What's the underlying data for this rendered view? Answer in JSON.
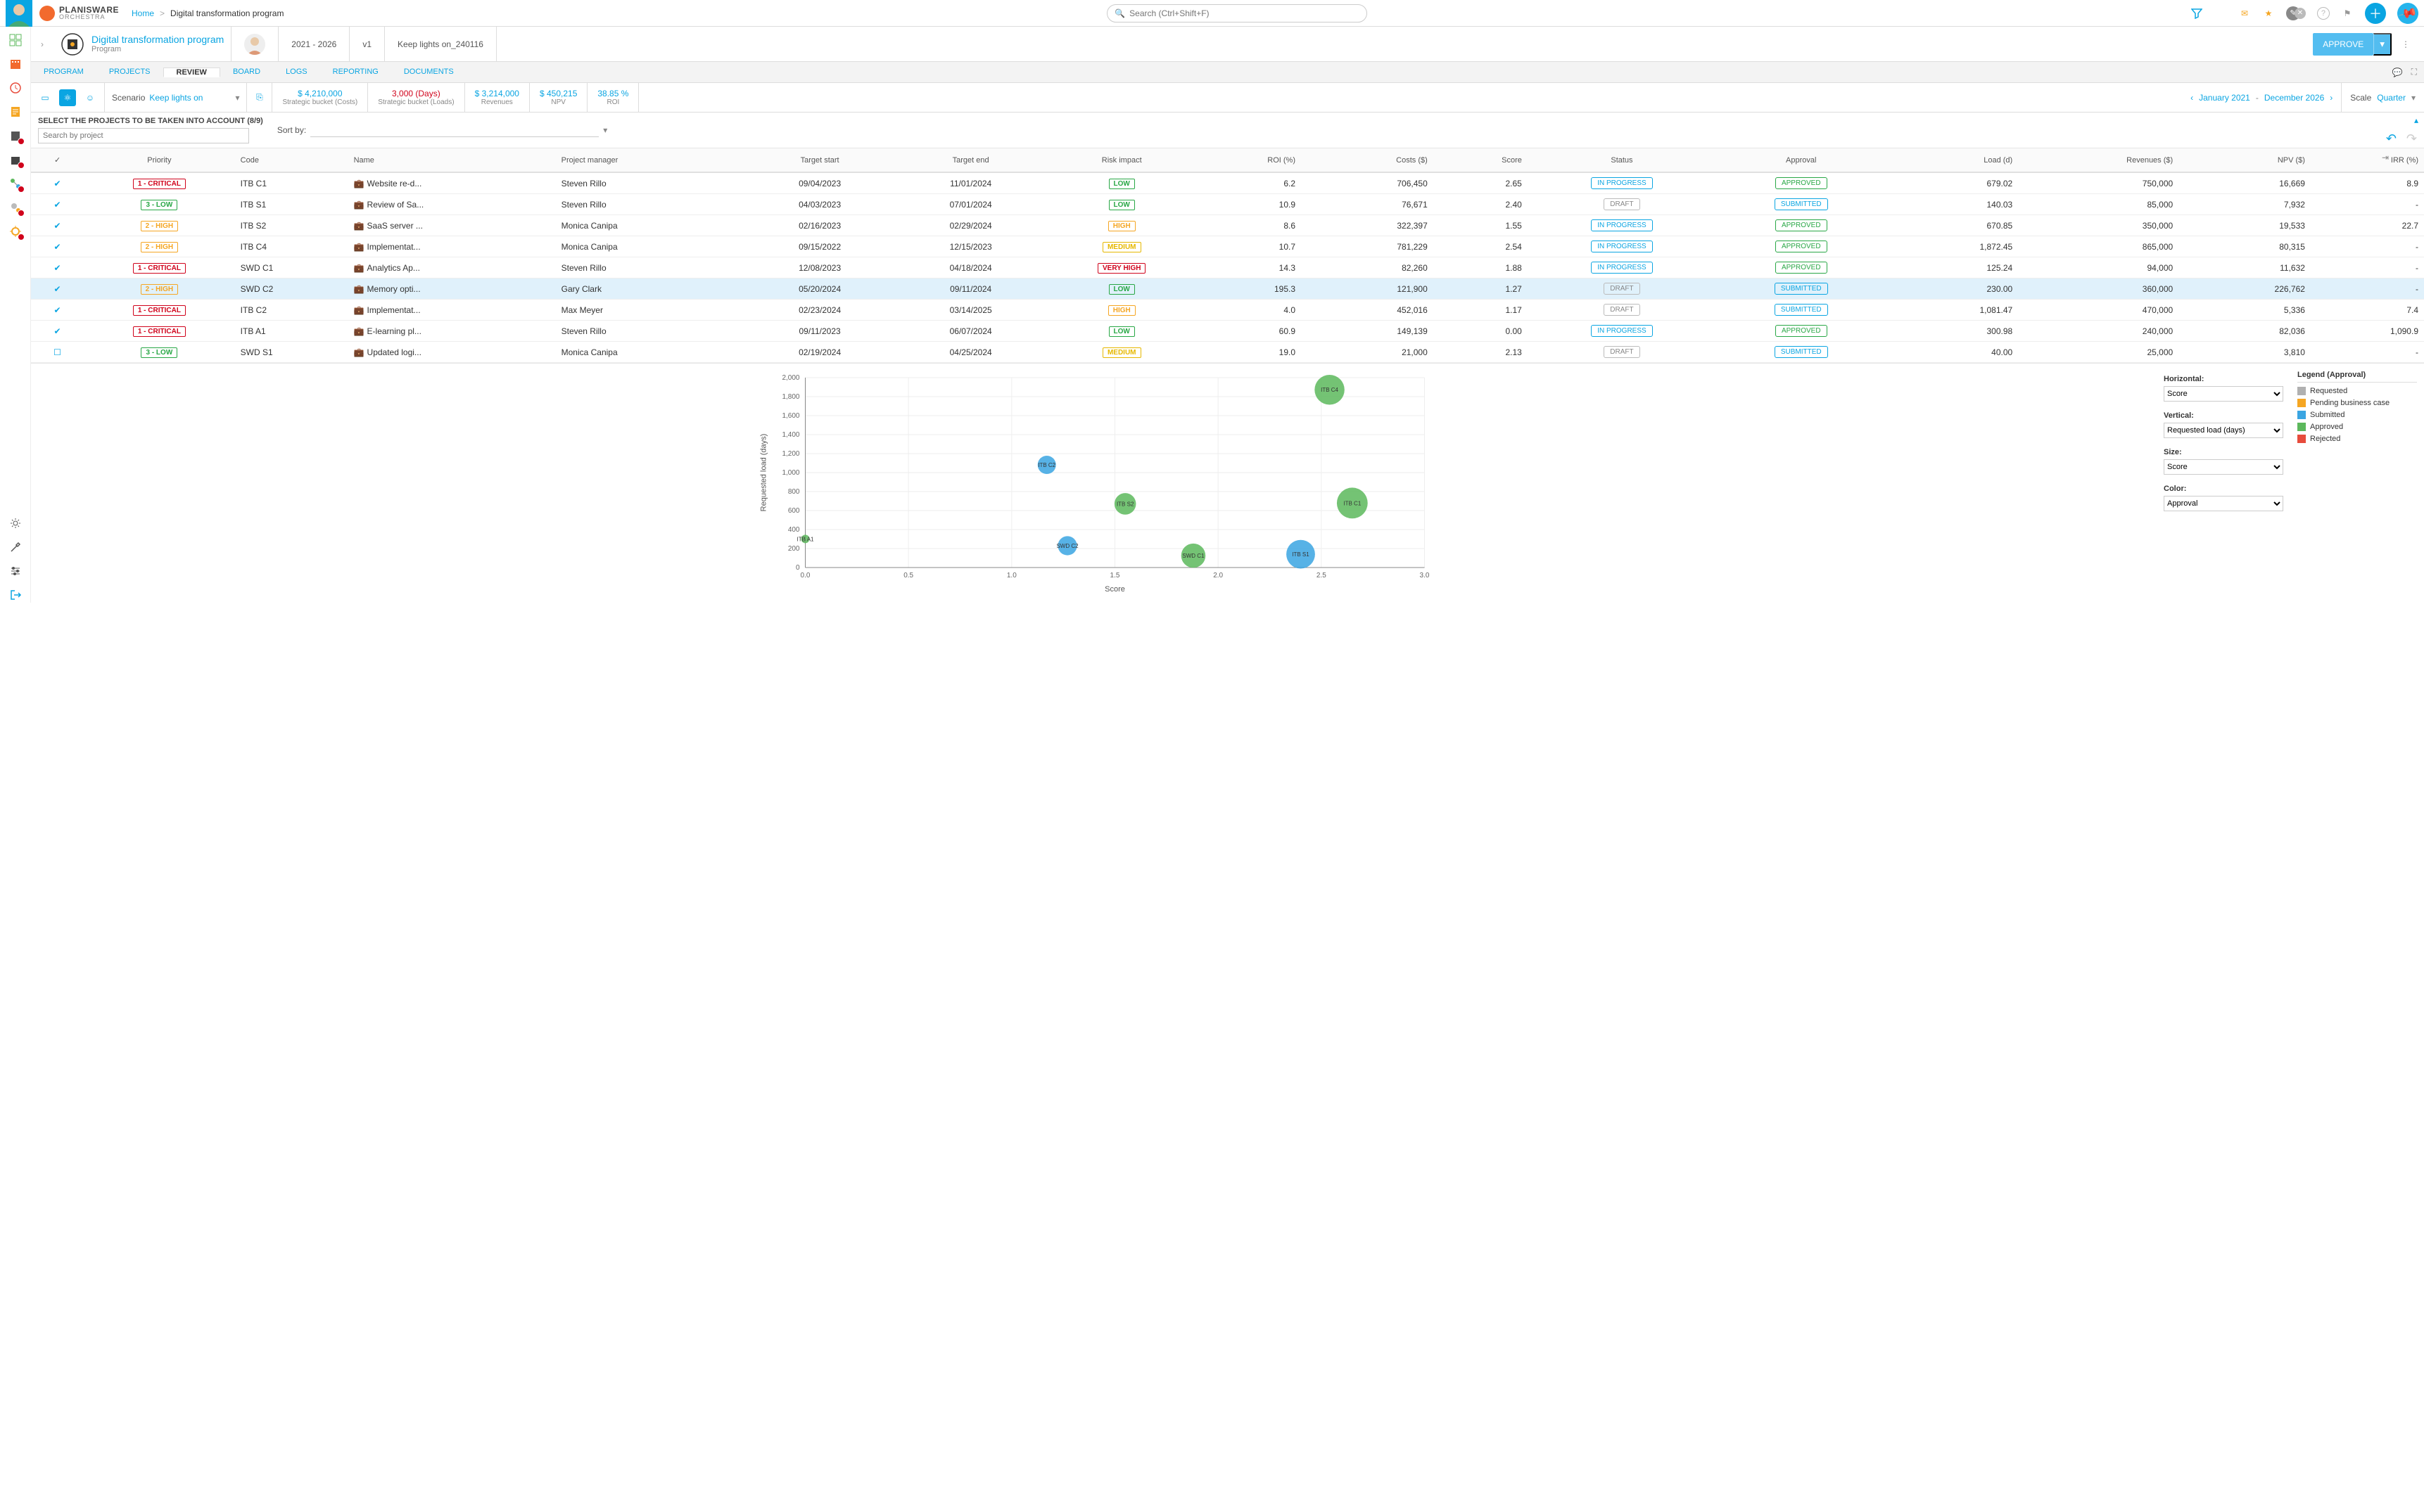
{
  "brand": {
    "line1": "PLANISWARE",
    "line2": "ORCHESTRA"
  },
  "breadcrumb": {
    "home": "Home",
    "sep": ">",
    "current": "Digital transformation program"
  },
  "search_placeholder": "Search (Ctrl+Shift+F)",
  "program": {
    "title": "Digital transformation program",
    "subtitle": "Program",
    "years": "2021 - 2026",
    "version": "v1",
    "scenario_name": "Keep lights on_240116",
    "approve_btn": "APPROVE"
  },
  "tabs": [
    "PROGRAM",
    "PROJECTS",
    "REVIEW",
    "BOARD",
    "LOGS",
    "REPORTING",
    "DOCUMENTS"
  ],
  "active_tab": "REVIEW",
  "scenario": {
    "label": "Scenario",
    "value": "Keep lights on"
  },
  "kpis": [
    {
      "value": "$ 4,210,000",
      "label": "Strategic bucket (Costs)",
      "cls": "blue"
    },
    {
      "value": "3,000 (Days)",
      "label": "Strategic bucket (Loads)",
      "cls": "red"
    },
    {
      "value": "$ 3,214,000",
      "label": "Revenues",
      "cls": "blue"
    },
    {
      "value": "$ 450,215",
      "label": "NPV",
      "cls": "blue"
    },
    {
      "value": "38.85 %",
      "label": "ROI",
      "cls": "blue"
    }
  ],
  "range": {
    "start": "January 2021",
    "end": "December 2026",
    "dash": "-"
  },
  "scale": {
    "label": "Scale",
    "value": "Quarter"
  },
  "select_title": "SELECT THE PROJECTS TO BE TAKEN INTO ACCOUNT (8/9)",
  "search_proj_ph": "Search by project",
  "sort_label": "Sort by:",
  "columns": [
    "✓",
    "Priority",
    "Code",
    "Name",
    "Project manager",
    "Target start",
    "Target end",
    "Risk impact",
    "ROI (%)",
    "Costs ($)",
    "Score",
    "Status",
    "Approval",
    "Load (d)",
    "Revenues ($)",
    "NPV ($)",
    "IRR (%)"
  ],
  "rows": [
    {
      "chk": true,
      "sel": false,
      "priority": "1 - CRITICAL",
      "pcls": "tag-crit",
      "code": "ITB C1",
      "name": "Website re-d...",
      "pm": "Steven Rillo",
      "start": "09/04/2023",
      "end": "11/01/2024",
      "risk": "LOW",
      "rcls": "tag-low",
      "roi": "6.2",
      "costs": "706,450",
      "score": "2.65",
      "status": "IN PROGRESS",
      "scls": "pill-prog",
      "approval": "APPROVED",
      "acls": "pill-appr",
      "load": "679.02",
      "rev": "750,000",
      "npv": "16,669",
      "irr": "8.9"
    },
    {
      "chk": true,
      "sel": false,
      "priority": "3 - LOW",
      "pcls": "tag-low",
      "code": "ITB S1",
      "name": "Review of Sa...",
      "pm": "Steven Rillo",
      "start": "04/03/2023",
      "end": "07/01/2024",
      "risk": "LOW",
      "rcls": "tag-low",
      "roi": "10.9",
      "costs": "76,671",
      "score": "2.40",
      "status": "DRAFT",
      "scls": "pill-draft",
      "approval": "SUBMITTED",
      "acls": "pill-sub",
      "load": "140.03",
      "rev": "85,000",
      "npv": "7,932",
      "irr": "-"
    },
    {
      "chk": true,
      "sel": false,
      "priority": "2 - HIGH",
      "pcls": "tag-high",
      "code": "ITB S2",
      "name": "SaaS server ...",
      "pm": "Monica Canipa",
      "start": "02/16/2023",
      "end": "02/29/2024",
      "risk": "HIGH",
      "rcls": "tag-high",
      "roi": "8.6",
      "costs": "322,397",
      "score": "1.55",
      "status": "IN PROGRESS",
      "scls": "pill-prog",
      "approval": "APPROVED",
      "acls": "pill-appr",
      "load": "670.85",
      "rev": "350,000",
      "npv": "19,533",
      "irr": "22.7"
    },
    {
      "chk": true,
      "sel": false,
      "priority": "2 - HIGH",
      "pcls": "tag-high",
      "code": "ITB C4",
      "name": "Implementat...",
      "pm": "Monica Canipa",
      "start": "09/15/2022",
      "end": "12/15/2023",
      "risk": "MEDIUM",
      "rcls": "tag-med",
      "roi": "10.7",
      "costs": "781,229",
      "score": "2.54",
      "status": "IN PROGRESS",
      "scls": "pill-prog",
      "approval": "APPROVED",
      "acls": "pill-appr",
      "load": "1,872.45",
      "rev": "865,000",
      "npv": "80,315",
      "irr": "-"
    },
    {
      "chk": true,
      "sel": false,
      "priority": "1 - CRITICAL",
      "pcls": "tag-crit",
      "code": "SWD C1",
      "name": "Analytics Ap...",
      "pm": "Steven Rillo",
      "start": "12/08/2023",
      "end": "04/18/2024",
      "risk": "VERY HIGH",
      "rcls": "tag-vh",
      "roi": "14.3",
      "costs": "82,260",
      "score": "1.88",
      "status": "IN PROGRESS",
      "scls": "pill-prog",
      "approval": "APPROVED",
      "acls": "pill-appr",
      "load": "125.24",
      "rev": "94,000",
      "npv": "11,632",
      "irr": "-"
    },
    {
      "chk": true,
      "sel": true,
      "priority": "2 - HIGH",
      "pcls": "tag-high",
      "code": "SWD C2",
      "name": "Memory opti...",
      "pm": "Gary Clark",
      "start": "05/20/2024",
      "end": "09/11/2024",
      "risk": "LOW",
      "rcls": "tag-low",
      "roi": "195.3",
      "costs": "121,900",
      "score": "1.27",
      "status": "DRAFT",
      "scls": "pill-draft",
      "approval": "SUBMITTED",
      "acls": "pill-sub",
      "load": "230.00",
      "rev": "360,000",
      "npv": "226,762",
      "irr": "-"
    },
    {
      "chk": true,
      "sel": false,
      "priority": "1 - CRITICAL",
      "pcls": "tag-crit",
      "code": "ITB C2",
      "name": "Implementat...",
      "pm": "Max Meyer",
      "start": "02/23/2024",
      "end": "03/14/2025",
      "risk": "HIGH",
      "rcls": "tag-high",
      "roi": "4.0",
      "costs": "452,016",
      "score": "1.17",
      "status": "DRAFT",
      "scls": "pill-draft",
      "approval": "SUBMITTED",
      "acls": "pill-sub",
      "load": "1,081.47",
      "rev": "470,000",
      "npv": "5,336",
      "irr": "7.4"
    },
    {
      "chk": true,
      "sel": false,
      "priority": "1 - CRITICAL",
      "pcls": "tag-crit",
      "code": "ITB A1",
      "name": "E-learning pl...",
      "pm": "Steven Rillo",
      "start": "09/11/2023",
      "end": "06/07/2024",
      "risk": "LOW",
      "rcls": "tag-low",
      "roi": "60.9",
      "costs": "149,139",
      "score": "0.00",
      "status": "IN PROGRESS",
      "scls": "pill-prog",
      "approval": "APPROVED",
      "acls": "pill-appr",
      "load": "300.98",
      "rev": "240,000",
      "npv": "82,036",
      "irr": "1,090.9"
    },
    {
      "chk": false,
      "sel": false,
      "priority": "3 - LOW",
      "pcls": "tag-low",
      "code": "SWD S1",
      "name": "Updated logi...",
      "pm": "Monica Canipa",
      "start": "02/19/2024",
      "end": "04/25/2024",
      "risk": "MEDIUM",
      "rcls": "tag-med",
      "roi": "19.0",
      "costs": "21,000",
      "score": "2.13",
      "status": "DRAFT",
      "scls": "pill-draft",
      "approval": "SUBMITTED",
      "acls": "pill-sub",
      "load": "40.00",
      "rev": "25,000",
      "npv": "3,810",
      "irr": "-"
    }
  ],
  "chart_controls": {
    "horizontal_label": "Horizontal:",
    "horizontal_value": "Score",
    "vertical_label": "Vertical:",
    "vertical_value": "Requested load (days)",
    "size_label": "Size:",
    "size_value": "Score",
    "color_label": "Color:",
    "color_value": "Approval"
  },
  "legend": {
    "title": "Legend (Approval)",
    "items": [
      {
        "label": "Requested",
        "color": "#b0b0b0"
      },
      {
        "label": "Pending business case",
        "color": "#f5a623"
      },
      {
        "label": "Submitted",
        "color": "#3aa5e2"
      },
      {
        "label": "Approved",
        "color": "#5cb85c"
      },
      {
        "label": "Rejected",
        "color": "#e74c3c"
      }
    ]
  },
  "chart_data": {
    "type": "scatter",
    "xlabel": "Score",
    "ylabel": "Requested load (days)",
    "xlim": [
      0.0,
      3.0
    ],
    "ylim": [
      0,
      2000
    ],
    "xticks": [
      0.0,
      0.5,
      1.0,
      1.5,
      2.0,
      2.5,
      3.0
    ],
    "yticks": [
      0,
      200,
      400,
      600,
      800,
      1000,
      1200,
      1400,
      1600,
      1800,
      2000
    ],
    "size_encoding": "Score",
    "color_encoding": "Approval",
    "series": [
      {
        "name": "Approved",
        "color": "#5cb85c",
        "points": [
          {
            "label": "ITB A1",
            "x": 0.0,
            "y": 300.98
          },
          {
            "label": "ITB S2",
            "x": 1.55,
            "y": 670.85
          },
          {
            "label": "SWD C1",
            "x": 1.88,
            "y": 125.24
          },
          {
            "label": "ITB C4",
            "x": 2.54,
            "y": 1872.45
          },
          {
            "label": "ITB C1",
            "x": 2.65,
            "y": 679.02
          }
        ]
      },
      {
        "name": "Submitted",
        "color": "#3aa5e2",
        "points": [
          {
            "label": "ITB C2",
            "x": 1.17,
            "y": 1081.47
          },
          {
            "label": "SWD C2",
            "x": 1.27,
            "y": 230.0
          },
          {
            "label": "ITB S1",
            "x": 2.4,
            "y": 140.03
          }
        ]
      }
    ]
  }
}
